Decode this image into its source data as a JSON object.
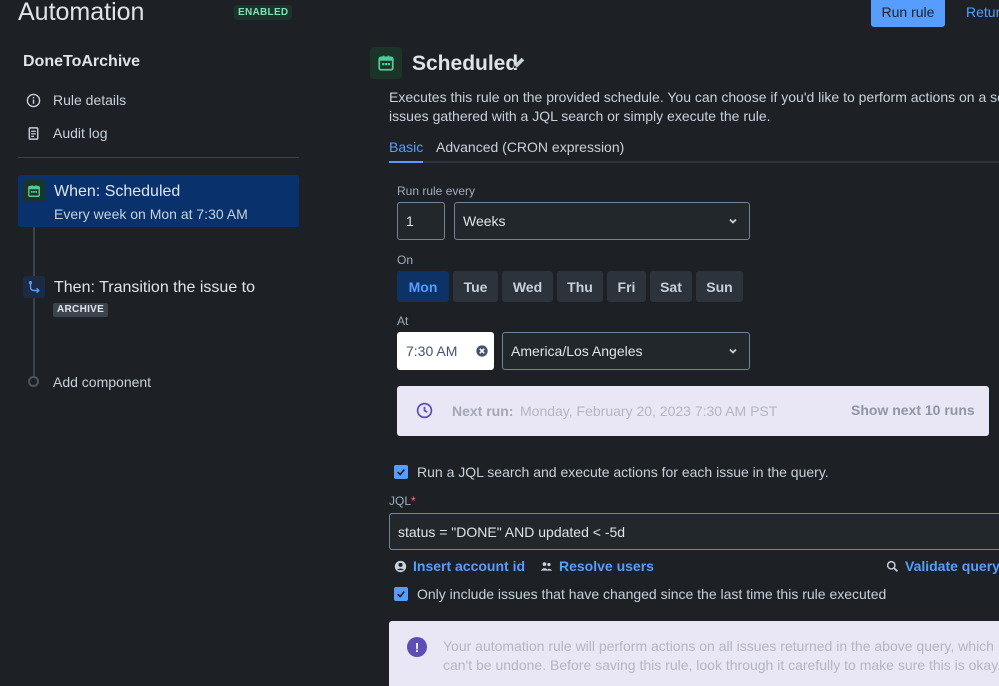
{
  "header": {
    "title": "Automation",
    "status_badge": "ENABLED",
    "run_rule_label": "Run rule",
    "return_label": "Return"
  },
  "sidebar": {
    "rule_name": "DoneToArchive",
    "links": [
      {
        "label": "Rule details",
        "icon": "info-icon"
      },
      {
        "label": "Audit log",
        "icon": "clipboard-icon"
      }
    ],
    "steps": [
      {
        "title": "When: Scheduled",
        "subtitle": "Every week on Mon at 7:30 AM",
        "icon": "calendar-icon",
        "selected": true
      },
      {
        "title": "Then: Transition the issue to",
        "tag": "ARCHIVE",
        "icon": "transition-icon",
        "selected": false
      }
    ],
    "add_component_label": "Add component"
  },
  "main": {
    "title": "Scheduled",
    "description_line1": "Executes this rule on the provided schedule. You can choose if you'd like to perform actions on a set of",
    "description_line2": "issues gathered with a JQL search or simply execute the rule.",
    "tabs": [
      {
        "label": "Basic",
        "active": true
      },
      {
        "label": "Advanced (CRON expression)",
        "active": false
      }
    ],
    "run_every_label": "Run rule every",
    "interval_value": "1",
    "interval_unit": "Weeks",
    "on_label": "On",
    "days": [
      {
        "label": "Mon",
        "selected": true
      },
      {
        "label": "Tue",
        "selected": false
      },
      {
        "label": "Wed",
        "selected": false
      },
      {
        "label": "Thu",
        "selected": false
      },
      {
        "label": "Fri",
        "selected": false
      },
      {
        "label": "Sat",
        "selected": false
      },
      {
        "label": "Sun",
        "selected": false
      }
    ],
    "at_label": "At",
    "time_value": "7:30 AM",
    "timezone": "America/Los Angeles",
    "next_run_label": "Next run:",
    "next_run_value": "Monday, February 20, 2023 7:30 AM PST",
    "show_next_label": "Show next 10 runs",
    "jql_checkbox_label": "Run a JQL search and execute actions for each issue in the query.",
    "jql_checkbox_checked": true,
    "jql_label": "JQL",
    "jql_required_mark": "*",
    "jql_value": "status = \"DONE\" AND updated < -5d",
    "insert_account_label": "Insert account id",
    "resolve_users_label": "Resolve users",
    "validate_query_label": "Validate query",
    "changed_checkbox_label": "Only include issues that have changed since the last time this rule executed",
    "changed_checkbox_checked": true,
    "warning_line1": "Your automation rule will perform actions on all issues returned in the above query, which",
    "warning_line2": "can't be undone. Before saving this rule, look through it carefully to make sure this is okay.",
    "warning_icon_glyph": "!"
  },
  "colors": {
    "background": "#1d2125",
    "accent": "#579dff",
    "selected_step": "#09326c",
    "enabled_badge": "#7ee2b8",
    "info_panel": "#e9e6f6"
  }
}
